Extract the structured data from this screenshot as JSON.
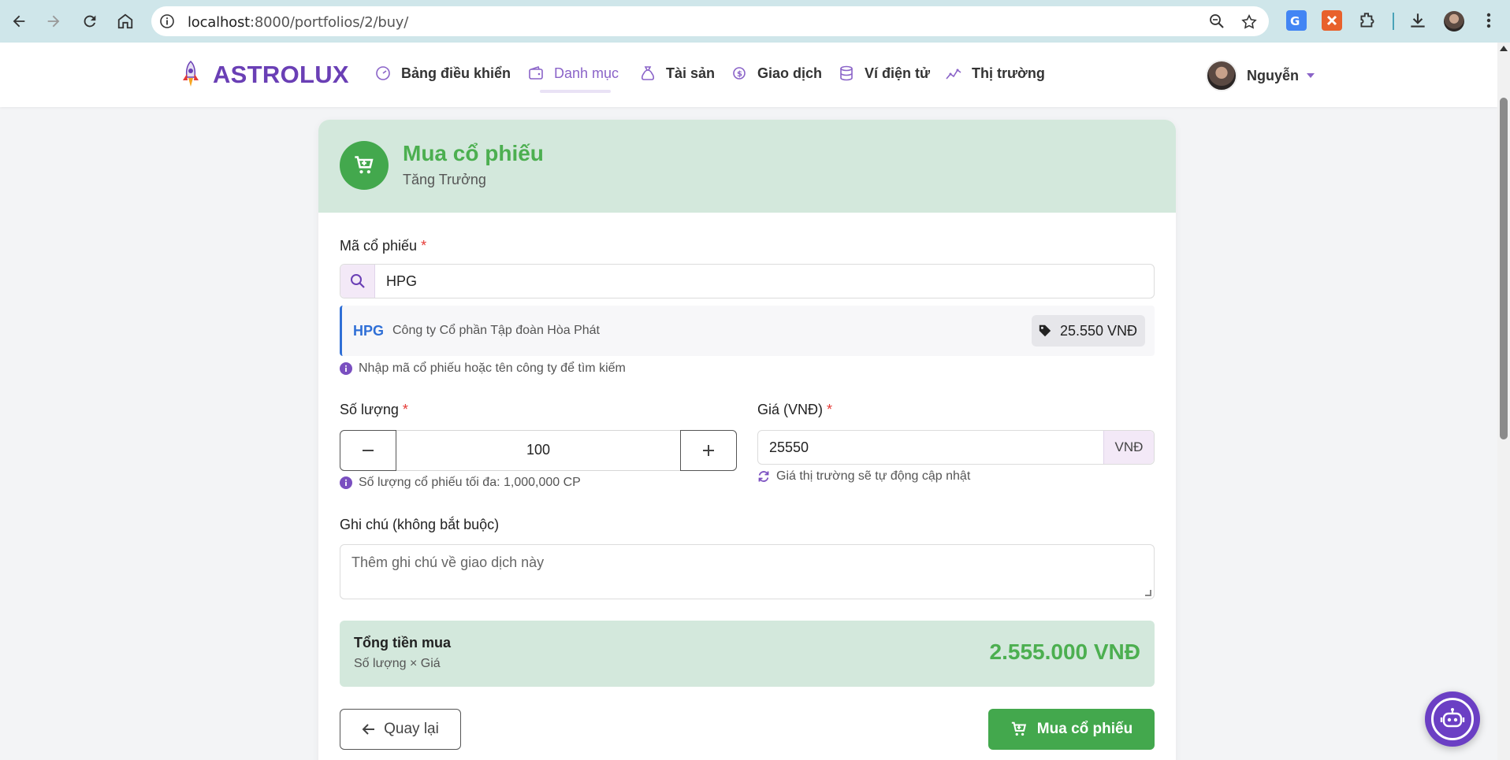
{
  "browser": {
    "url_host": "localhost",
    "url_rest": ":8000/portfolios/2/buy/"
  },
  "app": {
    "brand": "ASTROLUX",
    "nav": [
      {
        "label": "Bảng điều khiển",
        "icon": "gauge-icon"
      },
      {
        "label": "Danh mục",
        "icon": "wallet-icon"
      },
      {
        "label": "Tài sản",
        "icon": "money-bag-icon"
      },
      {
        "label": "Giao dịch",
        "icon": "coin-icon"
      },
      {
        "label": "Ví điện tử",
        "icon": "database-icon"
      },
      {
        "label": "Thị trường",
        "icon": "chart-line-icon"
      }
    ],
    "active_nav": "Danh mục",
    "user_name": "Nguyễn",
    "accent": "#6a3fb5"
  },
  "card": {
    "title": "Mua cổ phiếu",
    "subtitle": "Tăng Trưởng",
    "stock_label": "Mã cổ phiếu",
    "required_mark": "*",
    "stock_value": "HPG",
    "result_code": "HPG",
    "result_name": "Công ty Cổ phần Tập đoàn Hòa Phát",
    "result_price": "25.550 VNĐ",
    "stock_hint": "Nhập mã cổ phiếu hoặc tên công ty để tìm kiếm",
    "qty_label": "Số lượng",
    "qty_value": "100",
    "qty_hint": "Số lượng cổ phiếu tối đa: 1,000,000 CP",
    "price_label": "Giá (VNĐ)",
    "price_value": "25550",
    "price_unit": "VNĐ",
    "price_hint": "Giá thị trường sẽ tự động cập nhật",
    "note_label": "Ghi chú (không bắt buộc)",
    "note_placeholder": "Thêm ghi chú về giao dịch này",
    "total_label": "Tổng tiền mua",
    "total_formula": "Số lượng × Giá",
    "total_amount": "2.555.000 VNĐ",
    "back_label": "Quay lại",
    "buy_label": "Mua cổ phiếu",
    "green": "#43a84d"
  }
}
